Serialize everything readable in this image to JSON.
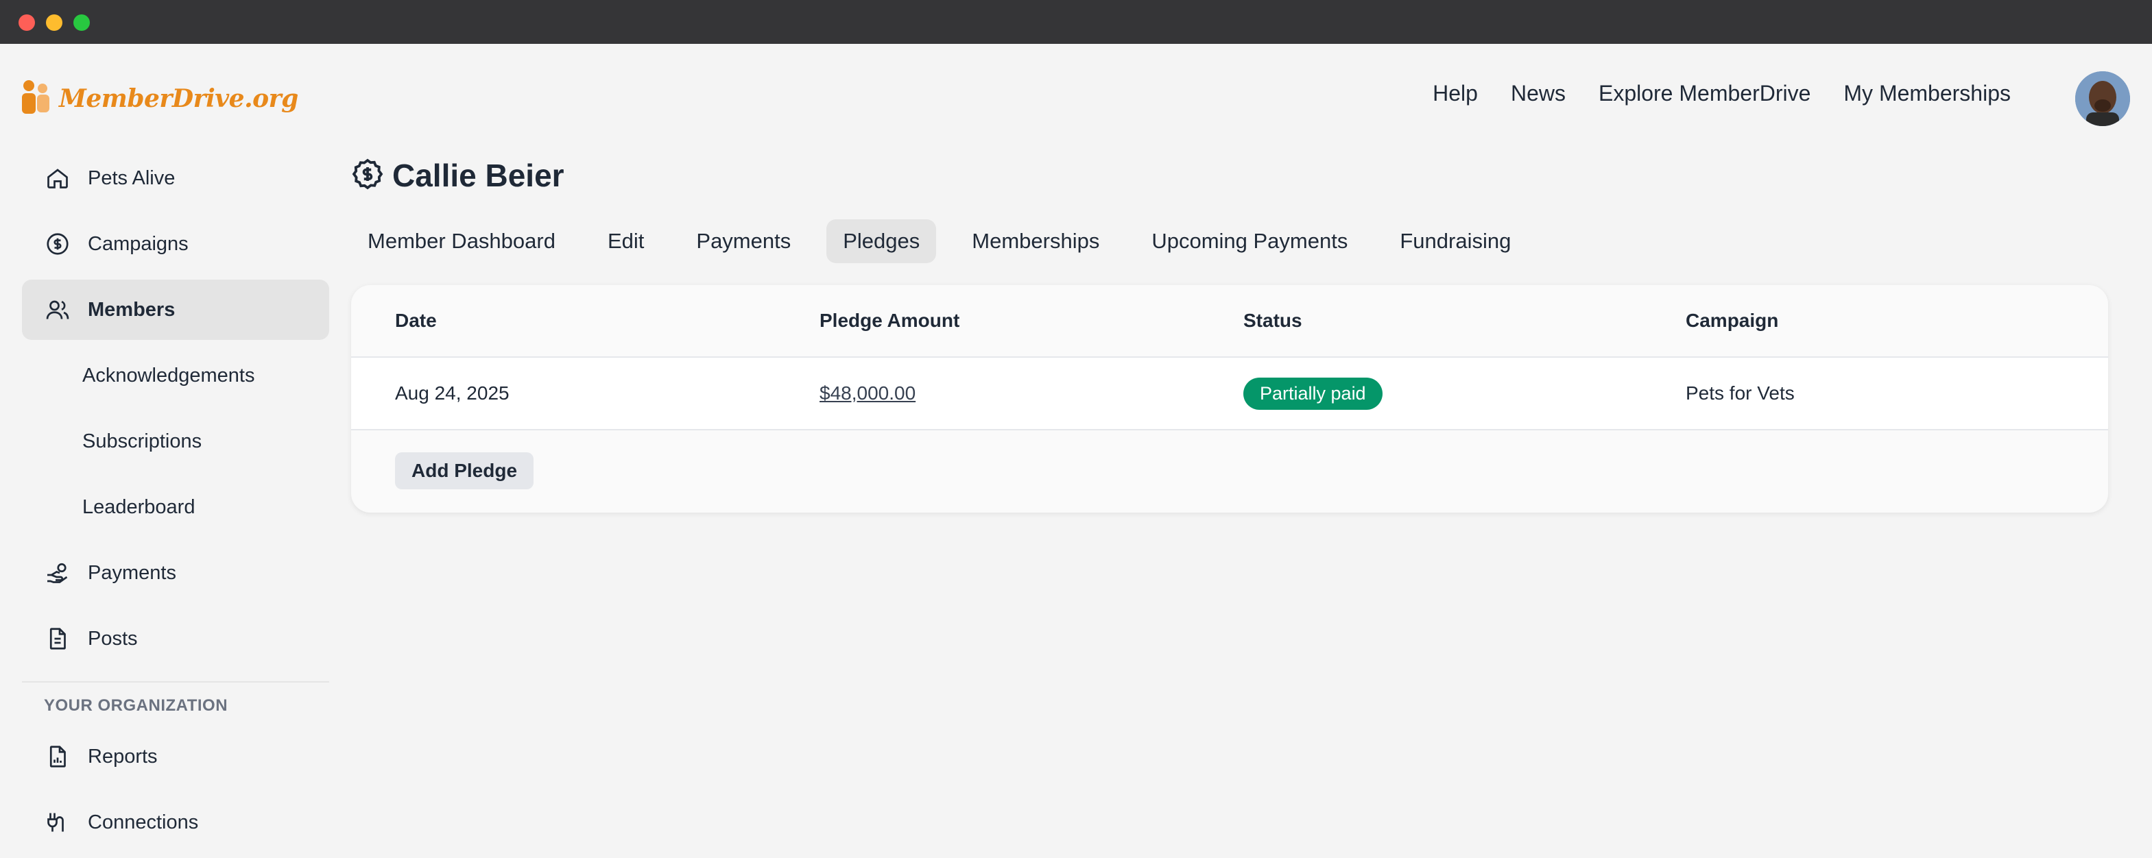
{
  "window": {
    "traffic_lights": [
      "close",
      "minimize",
      "zoom"
    ]
  },
  "brand": {
    "name": "MemberDrive.org",
    "color": "#e8891b"
  },
  "topnav": {
    "items": [
      "Help",
      "News",
      "Explore MemberDrive",
      "My Memberships"
    ]
  },
  "sidebar": {
    "items": [
      {
        "label": "Pets Alive",
        "icon": "home-icon"
      },
      {
        "label": "Campaigns",
        "icon": "dollar-badge-icon"
      },
      {
        "label": "Members",
        "icon": "users-icon",
        "active": true
      },
      {
        "label": "Acknowledgements",
        "sub": true
      },
      {
        "label": "Subscriptions",
        "sub": true
      },
      {
        "label": "Leaderboard",
        "sub": true
      },
      {
        "label": "Payments",
        "icon": "hand-coins-icon"
      },
      {
        "label": "Posts",
        "icon": "document-icon"
      }
    ],
    "section_heading": "YOUR ORGANIZATION",
    "org_items": [
      {
        "label": "Reports",
        "icon": "report-icon"
      },
      {
        "label": "Connections",
        "icon": "plug-icon"
      }
    ]
  },
  "page": {
    "title": "Callie Beier",
    "title_icon": "dollar-badge-icon"
  },
  "tabs": [
    {
      "label": "Member Dashboard"
    },
    {
      "label": "Edit"
    },
    {
      "label": "Payments"
    },
    {
      "label": "Pledges",
      "active": true
    },
    {
      "label": "Memberships"
    },
    {
      "label": "Upcoming Payments"
    },
    {
      "label": "Fundraising"
    }
  ],
  "table": {
    "headers": [
      "Date",
      "Pledge Amount",
      "Status",
      "Campaign"
    ],
    "rows": [
      {
        "date": "Aug 24, 2025",
        "amount": "$48,000.00",
        "status": "Partially paid",
        "campaign": "Pets for Vets"
      }
    ],
    "add_button": "Add Pledge"
  },
  "colors": {
    "status_partially_paid": "#059669",
    "active_bg": "#e4e4e4"
  }
}
